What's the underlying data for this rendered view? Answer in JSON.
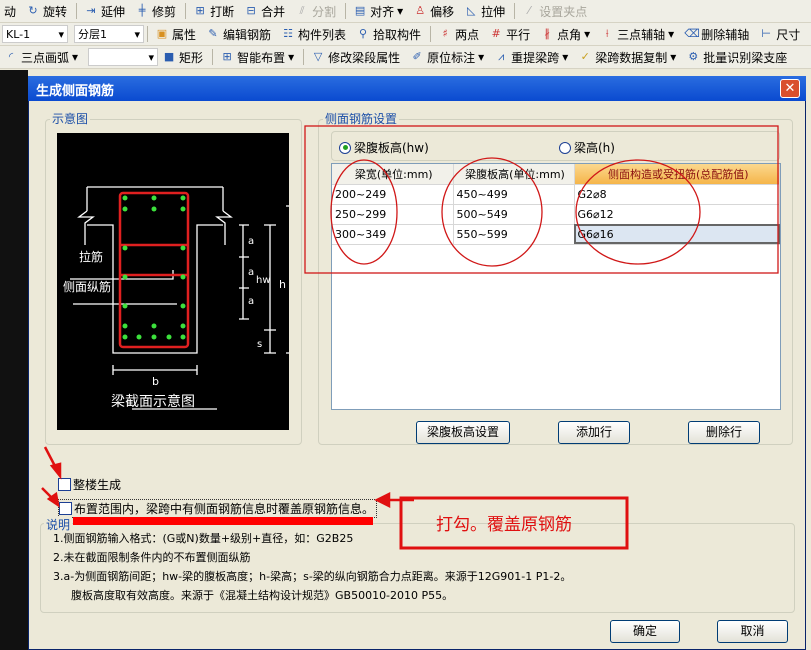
{
  "toolbar1": [
    "动",
    "旋转",
    "延伸",
    "修剪",
    "打断",
    "合并",
    "分割",
    "对齐",
    "偏移",
    "拉伸",
    "设置夹点"
  ],
  "toolbar2": {
    "component": "KL-1",
    "layer": "分层1",
    "items": [
      "属性",
      "编辑钢筋",
      "构件列表",
      "拾取构件",
      "两点",
      "平行",
      "点角",
      "三点辅轴",
      "删除辅轴",
      "尺寸"
    ]
  },
  "toolbar3": {
    "items": [
      "三点画弧",
      "矩形",
      "智能布置",
      "修改梁段属性",
      "原位标注",
      "重提梁跨",
      "梁跨数据复制",
      "批量识别梁支座"
    ]
  },
  "dialog": {
    "title": "生成侧面钢筋",
    "diagram_group": "示意图",
    "diagram": {
      "tie_label": "拉筋",
      "side_bar_label": "侧面纵筋",
      "caption": "梁截面示意图",
      "b": "b",
      "a": "a",
      "hw": "hw",
      "h": "h",
      "s": "s"
    },
    "settings_group": "侧面钢筋设置",
    "radio_hw": "梁腹板高(hw)",
    "radio_h": "梁高(h)",
    "radio_selected": "hw",
    "columns": [
      "梁宽(单位:mm)",
      "梁腹板高(单位:mm)",
      "侧面构造或受扭筋(总配筋值)"
    ],
    "rows": [
      [
        "200~249",
        "450~499",
        "G2⌀8"
      ],
      [
        "250~299",
        "500~549",
        "G6⌀12"
      ],
      [
        "300~349",
        "550~599",
        "G6⌀16"
      ]
    ],
    "btn_hw": "梁腹板高设置",
    "btn_add": "添加行",
    "btn_del": "删除行",
    "check_whole": "整楼生成",
    "check_override": "布置范围内，梁跨中有侧面钢筋信息时覆盖原钢筋信息。",
    "notes_group": "说明",
    "notes": [
      "1.侧面钢筋输入格式：(G或N)数量+级别+直径，如：G2B25",
      "2.未在截面限制条件内的不布置侧面纵筋",
      "3.a-为侧面钢筋间距；hw-梁的腹板高度；h-梁高；s-梁的纵向钢筋合力点距离。来源于12G901-1 P1-2。",
      "腹板高度取有效高度。来源于《混凝土结构设计规范》GB50010-2010 P55。"
    ],
    "ok": "确定",
    "cancel": "取消"
  },
  "annotation": {
    "text": "打勾。覆盖原钢筋",
    "color": "#e01010"
  }
}
